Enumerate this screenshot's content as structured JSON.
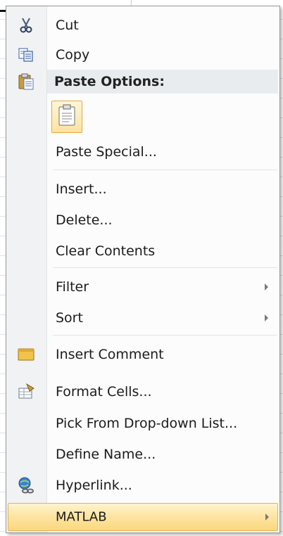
{
  "menu": {
    "items": [
      {
        "label": "Cut",
        "icon": "scissors-icon"
      },
      {
        "label": "Copy",
        "icon": "copy-icon"
      },
      {
        "label": "Paste Options:",
        "icon": "clipboard-icon"
      },
      {
        "label": "Paste Special...",
        "icon": ""
      },
      {
        "label": "Insert...",
        "icon": ""
      },
      {
        "label": "Delete...",
        "icon": ""
      },
      {
        "label": "Clear Contents",
        "icon": ""
      },
      {
        "label": "Filter",
        "icon": "",
        "submenu": true
      },
      {
        "label": "Sort",
        "icon": "",
        "submenu": true
      },
      {
        "label": "Insert Comment",
        "icon": "comment-icon"
      },
      {
        "label": "Format Cells...",
        "icon": "format-cells-icon"
      },
      {
        "label": "Pick From Drop-down List...",
        "icon": ""
      },
      {
        "label": "Define Name...",
        "icon": ""
      },
      {
        "label": "Hyperlink...",
        "icon": "hyperlink-icon"
      },
      {
        "label": "MATLAB",
        "icon": "",
        "submenu": true,
        "highlighted": true
      }
    ]
  },
  "colors": {
    "highlight": "#fde4a0",
    "gutter": "#f1f2f3",
    "border": "#979797"
  }
}
